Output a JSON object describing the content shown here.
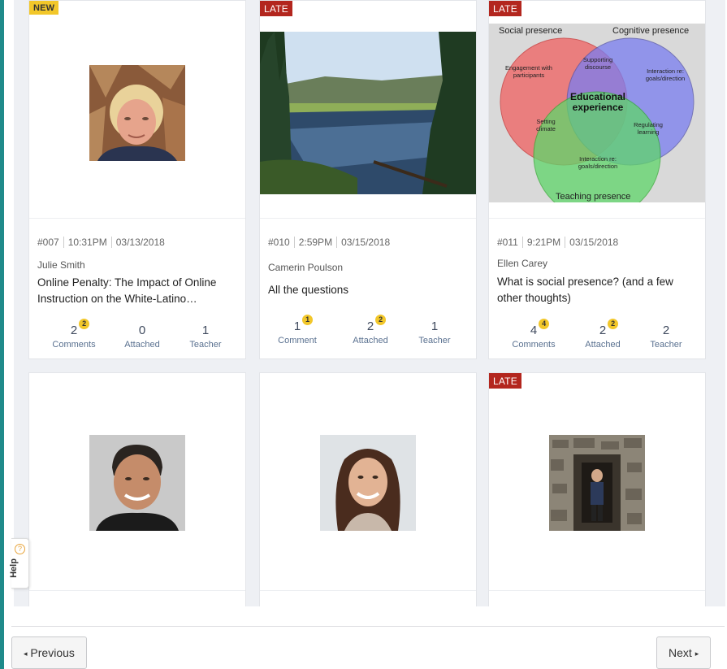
{
  "cards": [
    {
      "badge": "NEW",
      "id": "#007",
      "time": "10:31PM",
      "date": "03/13/2018",
      "author": "Julie Smith",
      "title": "Online Penalty: The Impact of Online Instruction on the White-Latino…",
      "stats": [
        {
          "value": "2",
          "dot": "2",
          "label": "Comments"
        },
        {
          "value": "0",
          "dot": "",
          "label": "Attached"
        },
        {
          "value": "1",
          "dot": "",
          "label": "Teacher"
        }
      ]
    },
    {
      "badge": "LATE",
      "id": "#010",
      "time": "2:59PM",
      "date": "03/15/2018",
      "author": "Camerin Poulson",
      "title": "All the questions",
      "stats": [
        {
          "value": "1",
          "dot": "1",
          "label": "Comment"
        },
        {
          "value": "2",
          "dot": "2",
          "label": "Attached"
        },
        {
          "value": "1",
          "dot": "",
          "label": "Teacher"
        }
      ]
    },
    {
      "badge": "LATE",
      "id": "#011",
      "time": "9:21PM",
      "date": "03/15/2018",
      "author": "Ellen Carey",
      "title": "What is social presence? (and a few other thoughts)",
      "venn": {
        "social": "Social presence",
        "cognitive": "Cognitive presence",
        "teaching": "Teaching presence",
        "engagement": "Engagement with participants",
        "supporting": "Supporting discourse",
        "interaction_top": "Interaction re: goals/direction",
        "center": "Educational experience",
        "setting": "Setting climate",
        "regulating": "Regulating learning",
        "interaction_bottom": "Interaction re: goals/direction"
      },
      "stats": [
        {
          "value": "4",
          "dot": "4",
          "label": "Comments"
        },
        {
          "value": "2",
          "dot": "2",
          "label": "Attached"
        },
        {
          "value": "2",
          "dot": "",
          "label": "Teacher"
        }
      ]
    },
    {
      "badge": ""
    },
    {
      "badge": ""
    },
    {
      "badge": "LATE"
    }
  ],
  "help": {
    "label": "Help",
    "icon": "?"
  },
  "pager": {
    "previous": "Previous",
    "next": "Next"
  },
  "colors": {
    "late": "#b3261e",
    "new": "#f2c72a",
    "rail": "#1f8a8a"
  }
}
